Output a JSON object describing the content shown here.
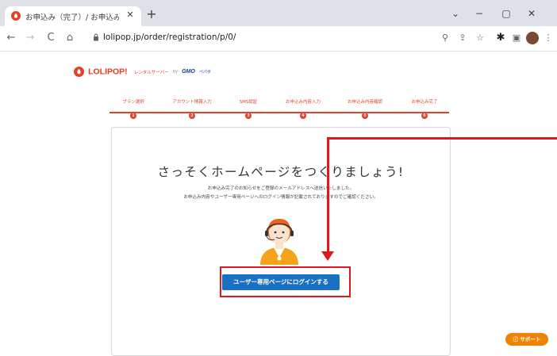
{
  "browser": {
    "tab_title": "お申込み（完了）/ お申込み - D",
    "tab_close": "✕",
    "new_tab": "+",
    "url": "lolipop.jp/order/registration/p/0/",
    "window": {
      "collapse": "⌄",
      "minimize": "−",
      "maximize": "▢",
      "close": "✕"
    },
    "nav": {
      "back": "←",
      "forward": "→",
      "reload": "C",
      "home": "⌂"
    },
    "toolbar_icons": {
      "zoom": "⚲",
      "share": "⇪",
      "bookmark": "☆",
      "extensions": "✱",
      "sidepanel": "▣",
      "menu": "⋮"
    }
  },
  "logo": {
    "main": "LOLIPOP!",
    "sub": "レンタルサーバー",
    "by": "by",
    "gmo": "GMO",
    "gmo_sub": "ペパボ"
  },
  "steps": [
    {
      "label": "プラン選択",
      "number": "1"
    },
    {
      "label": "アカウント情報入力",
      "number": "2"
    },
    {
      "label": "SMS認証",
      "number": "3"
    },
    {
      "label": "お申込み内容入力",
      "number": "4"
    },
    {
      "label": "お申込み内容確認",
      "number": "5"
    },
    {
      "label": "お申込み完了",
      "number": "6"
    }
  ],
  "card": {
    "title": "さっそくホームページをつくりましょう!",
    "line1": "お申込み完了のお知らせをご登録のメールアドレスへ送信いたしました。",
    "line2": "お申込み内容やユーザー専用ページへのログイン情報が記載されておりますのでご確認ください。",
    "button": "ユーザー専用ページにログインする"
  },
  "support_button": "サポート",
  "colors": {
    "brand": "#e4402b",
    "cta": "#1971c2",
    "annotation": "#e0181c",
    "support": "#f08300"
  }
}
